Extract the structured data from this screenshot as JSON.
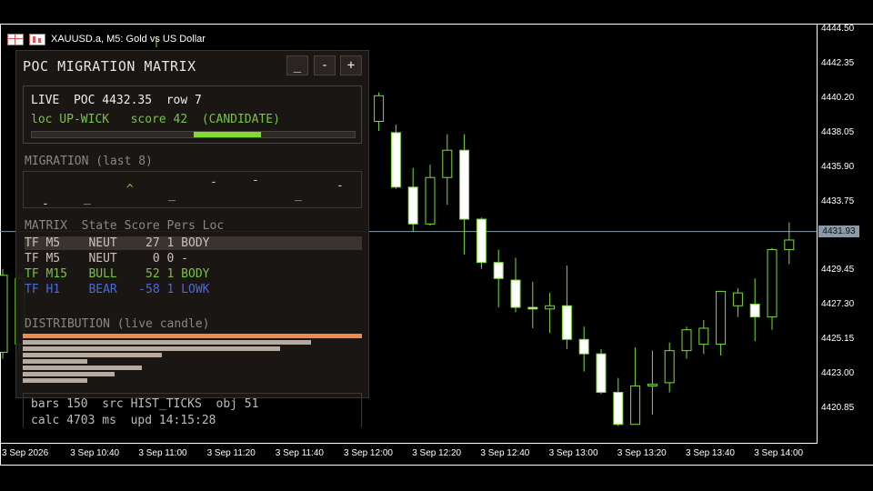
{
  "header": {
    "symbol_text": "XAUUSD.a, M5:  Gold vs US Dollar"
  },
  "chart_data": {
    "type": "candlestick",
    "symbol": "XAUUSD.a",
    "timeframe": "M5",
    "y_ticks": [
      4444.5,
      4442.35,
      4440.2,
      4438.05,
      4435.9,
      4433.75,
      4431.6,
      4429.45,
      4427.3,
      4425.15,
      4423.0,
      4420.85
    ],
    "y_tick_labels": [
      "4444.50",
      "4442.35",
      "4440.20",
      "4438.05",
      "4435.90",
      "4433.75",
      "4431.60",
      "4429.45",
      "4427.30",
      "4425.15",
      "4423.00",
      "4420.85"
    ],
    "ylim": [
      4418.8,
      4446.6
    ],
    "x_tick_labels": [
      "3 Sep 2026",
      "3 Sep 10:40",
      "3 Sep 11:00",
      "3 Sep 11:20",
      "3 Sep 11:40",
      "3 Sep 12:00",
      "3 Sep 12:20",
      "3 Sep 12:40",
      "3 Sep 13:00",
      "3 Sep 13:20",
      "3 Sep 13:40",
      "3 Sep 14:00"
    ],
    "current_price": 4431.93,
    "current_price_label": "4431.93",
    "candles": [
      {
        "i": 0,
        "o": 4424.4,
        "h": 4429.6,
        "l": 4424.0,
        "c": 4429.2
      },
      {
        "i": 1,
        "o": 4424.9,
        "h": 4429.3,
        "l": 4424.3,
        "c": 4429.0
      },
      {
        "i": 22,
        "o": 4438.8,
        "h": 4440.6,
        "l": 4438.2,
        "c": 4440.4
      },
      {
        "i": 23,
        "o": 4438.1,
        "h": 4438.6,
        "l": 4434.6,
        "c": 4434.7
      },
      {
        "i": 24,
        "o": 4434.7,
        "h": 4435.9,
        "l": 4431.9,
        "c": 4432.4
      },
      {
        "i": 25,
        "o": 4432.4,
        "h": 4436.1,
        "l": 4432.3,
        "c": 4435.3
      },
      {
        "i": 26,
        "o": 4435.3,
        "h": 4438.0,
        "l": 4433.6,
        "c": 4437.0
      },
      {
        "i": 27,
        "o": 4437.0,
        "h": 4438.0,
        "l": 4430.5,
        "c": 4432.7
      },
      {
        "i": 28,
        "o": 4432.7,
        "h": 4432.8,
        "l": 4429.6,
        "c": 4430.0
      },
      {
        "i": 29,
        "o": 4430.0,
        "h": 4430.8,
        "l": 4427.2,
        "c": 4429.0
      },
      {
        "i": 30,
        "o": 4428.9,
        "h": 4430.3,
        "l": 4426.9,
        "c": 4427.2
      },
      {
        "i": 31,
        "o": 4427.2,
        "h": 4428.8,
        "l": 4425.9,
        "c": 4427.1
      },
      {
        "i": 32,
        "o": 4427.1,
        "h": 4428.1,
        "l": 4425.6,
        "c": 4427.3
      },
      {
        "i": 33,
        "o": 4427.3,
        "h": 4429.8,
        "l": 4424.6,
        "c": 4425.2
      },
      {
        "i": 34,
        "o": 4425.2,
        "h": 4426.0,
        "l": 4423.2,
        "c": 4424.3
      },
      {
        "i": 35,
        "o": 4424.3,
        "h": 4424.6,
        "l": 4421.8,
        "c": 4421.9
      },
      {
        "i": 36,
        "o": 4421.9,
        "h": 4422.8,
        "l": 4419.8,
        "c": 4419.9
      },
      {
        "i": 37,
        "o": 4419.9,
        "h": 4424.7,
        "l": 4419.9,
        "c": 4422.3
      },
      {
        "i": 38,
        "o": 4422.3,
        "h": 4424.5,
        "l": 4420.5,
        "c": 4422.4
      },
      {
        "i": 39,
        "o": 4422.5,
        "h": 4425.0,
        "l": 4421.9,
        "c": 4424.5
      },
      {
        "i": 40,
        "o": 4424.5,
        "h": 4426.0,
        "l": 4424.0,
        "c": 4425.8
      },
      {
        "i": 41,
        "o": 4424.9,
        "h": 4426.4,
        "l": 4424.3,
        "c": 4425.9
      },
      {
        "i": 42,
        "o": 4424.9,
        "h": 4428.2,
        "l": 4424.2,
        "c": 4428.2
      },
      {
        "i": 43,
        "o": 4427.3,
        "h": 4428.4,
        "l": 4426.6,
        "c": 4428.1
      },
      {
        "i": 44,
        "o": 4427.4,
        "h": 4429.0,
        "l": 4425.1,
        "c": 4426.6
      },
      {
        "i": 45,
        "o": 4426.6,
        "h": 4430.9,
        "l": 4425.8,
        "c": 4430.8
      },
      {
        "i": 46,
        "o": 4430.8,
        "h": 4432.5,
        "l": 4429.9,
        "c": 4431.4
      }
    ]
  },
  "panel": {
    "title": "POC MIGRATION MATRIX",
    "buttons": [
      "_",
      "-",
      "+"
    ],
    "live_line1": "LIVE  POC 4432.35  row 7",
    "live_line2": "loc UP-WICK   score 42  (CANDIDATE)",
    "score_bar": {
      "start": 0.5,
      "end": 0.71
    },
    "migration_title": "MIGRATION (last 8)",
    "migration_marks": [
      "-",
      "_",
      "^",
      "_",
      "-",
      "-",
      "_",
      "-"
    ],
    "matrix_header": "MATRIX  State Score Pers Loc",
    "matrix_rows": [
      {
        "text": "TF M5    NEUT    27 1 BODY",
        "color": "#c8c2bc",
        "highlight": true
      },
      {
        "text": "TF M5    NEUT     0 0 -",
        "color": "#c8c2bc",
        "highlight": false
      },
      {
        "text": "TF M15   BULL    52 1 BODY",
        "color": "#76c443",
        "highlight": false
      },
      {
        "text": "TF H1    BEAR   -58 1 LOWK",
        "color": "#4a6ad8",
        "highlight": false
      }
    ],
    "distribution_title": "DISTRIBUTION (live candle)",
    "distribution_bars": [
      1.0,
      0.85,
      0.76,
      0.41,
      0.19,
      0.35,
      0.27,
      0.19
    ],
    "distribution_colors": [
      "#f08a4b",
      "#b7aba0"
    ],
    "footer_line1": "bars 150  src HIST_TICKS  obj 51",
    "footer_line2": "calc 4703 ms  upd 14:15:28"
  }
}
